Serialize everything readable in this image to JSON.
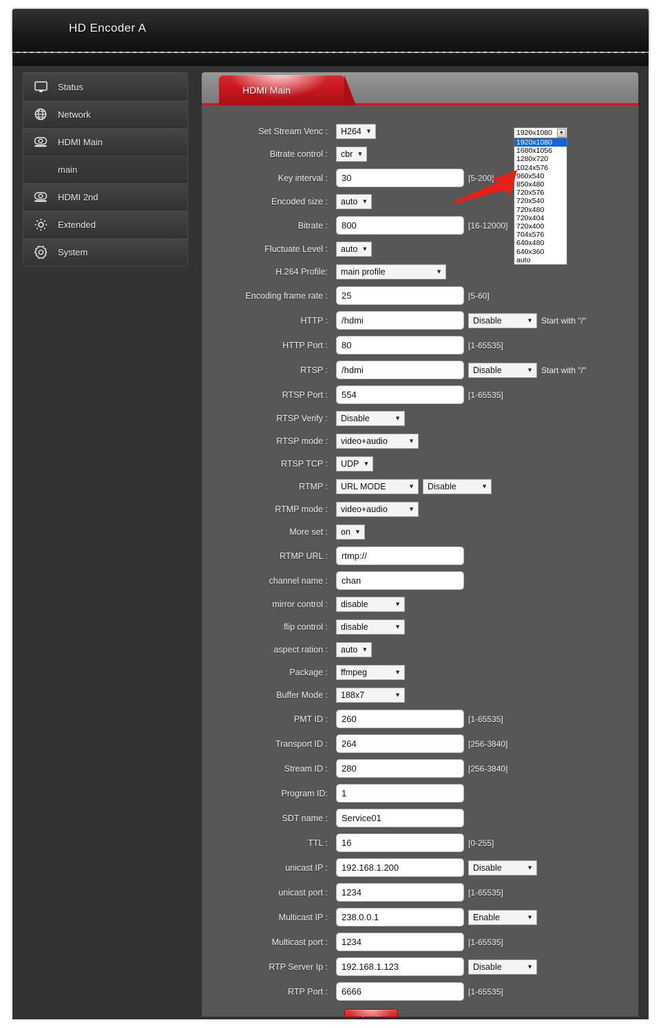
{
  "header": {
    "title": "HD Encoder  A"
  },
  "sidebar": {
    "items": [
      {
        "label": "Status",
        "icon": "monitor-icon"
      },
      {
        "label": "Network",
        "icon": "globe-icon"
      },
      {
        "label": "HDMI Main",
        "icon": "camera-icon"
      },
      {
        "label": "HDMI 2nd",
        "icon": "camera-icon"
      },
      {
        "label": "Extended",
        "icon": "brightness-icon"
      },
      {
        "label": "System",
        "icon": "gear-icon"
      }
    ],
    "sub_item": {
      "label": "main"
    }
  },
  "panel": {
    "tab_label": "HDMI Main",
    "accent_color": "#c4151c"
  },
  "form": {
    "rows": [
      {
        "label": "Set Stream Venc :",
        "type": "select",
        "value": "H264"
      },
      {
        "label": "Bitrate control :",
        "type": "select",
        "value": "cbr"
      },
      {
        "label": "Key interval :",
        "type": "text",
        "value": "30",
        "hint": "[5-200]"
      },
      {
        "label": "Encoded size :",
        "type": "select",
        "value": "auto"
      },
      {
        "label": "Bitrate :",
        "type": "text",
        "value": "800",
        "hint": "[16-12000]"
      },
      {
        "label": "Fluctuate Level :",
        "type": "select",
        "value": "auto"
      },
      {
        "label": "H.264 Profile:",
        "type": "select",
        "value": "main profile"
      },
      {
        "label": "Encoding frame rate :",
        "type": "text",
        "value": "25",
        "hint": "[5-60]"
      },
      {
        "label": "HTTP :",
        "type": "text-select",
        "value": "/hdmi",
        "select": "Disable",
        "note": "Start with \"/\""
      },
      {
        "label": "HTTP Port :",
        "type": "text",
        "value": "80",
        "hint": "[1-65535]"
      },
      {
        "label": "RTSP :",
        "type": "text-select",
        "value": "/hdmi",
        "select": "Disable",
        "note": "Start with \"/\""
      },
      {
        "label": "RTSP Port :",
        "type": "text",
        "value": "554",
        "hint": "[1-65535]"
      },
      {
        "label": "RTSP Verify :",
        "type": "select",
        "value": "Disable"
      },
      {
        "label": "RTSP mode :",
        "type": "select",
        "value": "video+audio"
      },
      {
        "label": "RTSP TCP :",
        "type": "select",
        "value": "UDP"
      },
      {
        "label": "RTMP :",
        "type": "select2",
        "value": "URL MODE",
        "select": "Disable"
      },
      {
        "label": "RTMP mode :",
        "type": "select",
        "value": "video+audio"
      },
      {
        "label": "More set :",
        "type": "select",
        "value": "on"
      },
      {
        "label": "RTMP URL :",
        "type": "text",
        "value": "rtmp://"
      },
      {
        "label": "channel name :",
        "type": "text",
        "value": "chan"
      },
      {
        "label": "mirror control :",
        "type": "select",
        "value": "disable"
      },
      {
        "label": "flip control :",
        "type": "select",
        "value": "disable"
      },
      {
        "label": "aspect ration :",
        "type": "select",
        "value": "auto"
      },
      {
        "label": "Package :",
        "type": "select",
        "value": "ffmpeg"
      },
      {
        "label": "Buffer Mode :",
        "type": "select",
        "value": "188x7"
      },
      {
        "label": "PMT ID :",
        "type": "text",
        "value": "260",
        "hint": "[1-65535]"
      },
      {
        "label": "Transport ID :",
        "type": "text",
        "value": "264",
        "hint": "[256-3840]"
      },
      {
        "label": "Stream ID :",
        "type": "text",
        "value": "280",
        "hint": "[256-3840]"
      },
      {
        "label": "Program ID:",
        "type": "text",
        "value": "1"
      },
      {
        "label": "SDT name :",
        "type": "text",
        "value": "Service01"
      },
      {
        "label": "TTL :",
        "type": "text",
        "value": "16",
        "hint": "[0-255]"
      },
      {
        "label": "unicast IP :",
        "type": "text-select",
        "value": "192.168.1.200",
        "select": "Disable"
      },
      {
        "label": "unicast port :",
        "type": "text",
        "value": "1234",
        "hint": "[1-65535]"
      },
      {
        "label": "Multicast IP :",
        "type": "text-select",
        "value": "238.0.0.1",
        "select": "Enable"
      },
      {
        "label": "Multicast port :",
        "type": "text",
        "value": "1234",
        "hint": "[1-65535]"
      },
      {
        "label": "RTP Server Ip :",
        "type": "text-select",
        "value": "192.168.1.123",
        "select": "Disable"
      },
      {
        "label": "RTP Port :",
        "type": "text",
        "value": "6666",
        "hint": "[1-65535]"
      }
    ],
    "apply_label": "Apply"
  },
  "resolution_dropdown": {
    "selected": "1920x1080",
    "options": [
      "1920x1080",
      "1680x1056",
      "1280x720",
      "1024x576",
      "960x540",
      "850x480",
      "720x576",
      "720x540",
      "720x480",
      "720x404",
      "720x400",
      "704x576",
      "640x480",
      "640x360",
      "auto"
    ],
    "highlight_color": "#1565d8"
  },
  "annotation": {
    "arrow_color": "#e8201a"
  }
}
